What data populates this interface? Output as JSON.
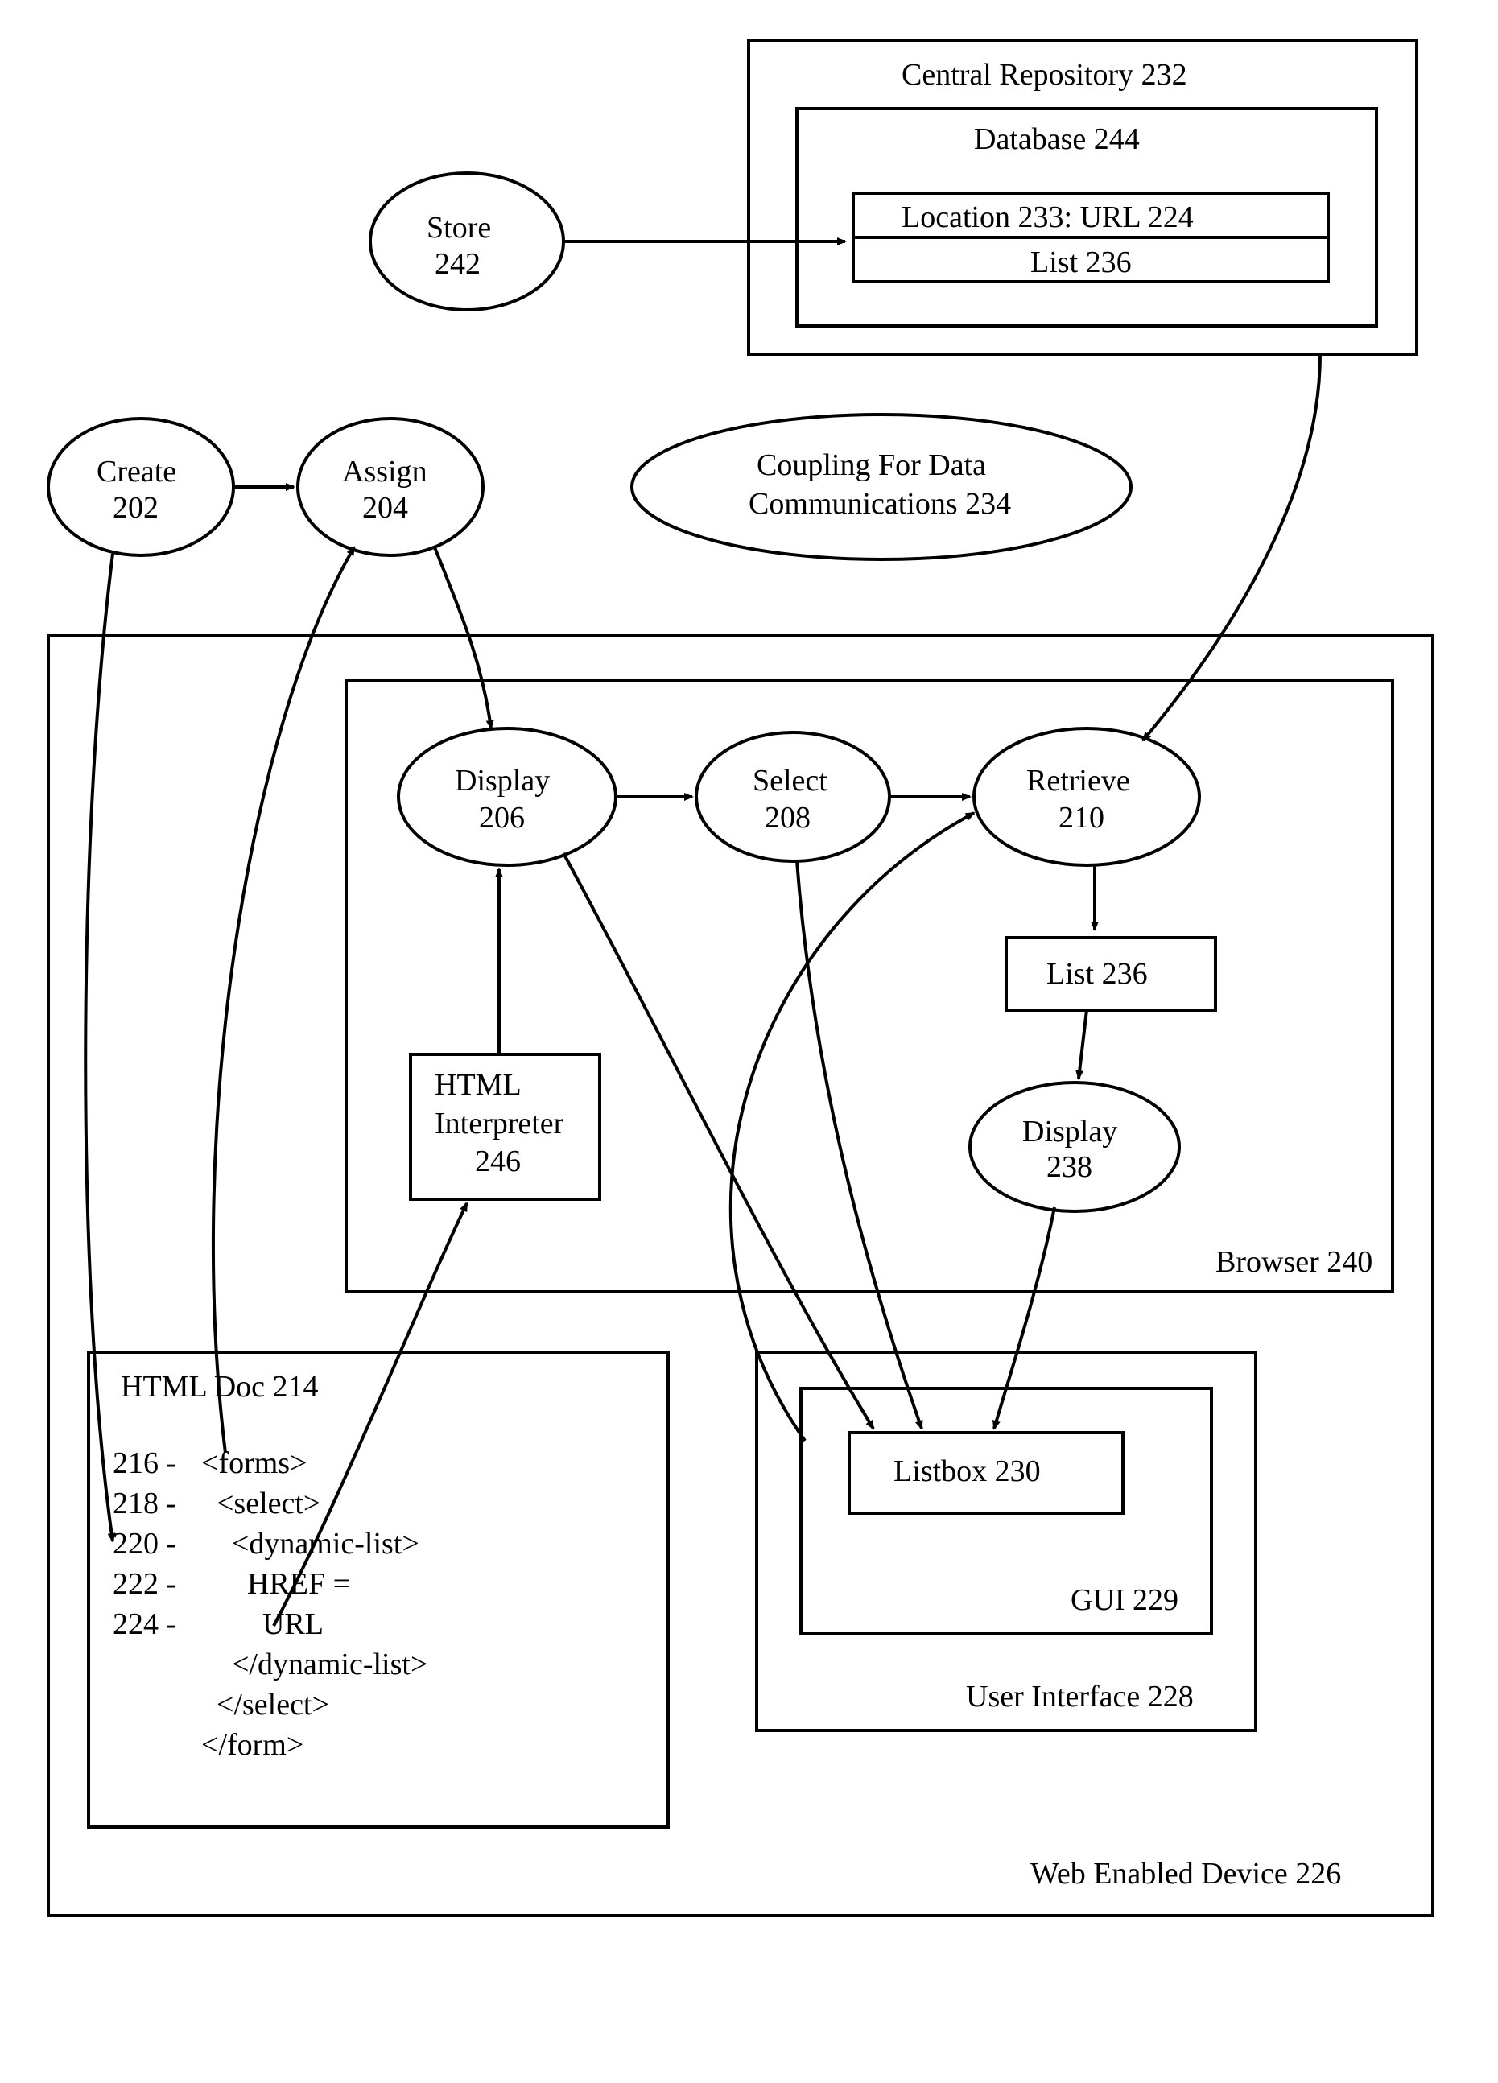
{
  "repo": {
    "title": "Central Repository 232"
  },
  "db": {
    "title": "Database 244",
    "row1": "Location 233: URL 224",
    "row2": "List 236"
  },
  "store": {
    "l1": "Store",
    "l2": "242"
  },
  "create": {
    "l1": "Create",
    "l2": "202"
  },
  "assign": {
    "l1": "Assign",
    "l2": "204"
  },
  "coupling": {
    "l1": "Coupling For Data",
    "l2": "Communications 234"
  },
  "browser": {
    "title": "Browser 240"
  },
  "display": {
    "l1": "Display",
    "l2": "206"
  },
  "select": {
    "l1": "Select",
    "l2": "208"
  },
  "retrieve": {
    "l1": "Retrieve",
    "l2": "210"
  },
  "list": {
    "l1": "List 236"
  },
  "display2": {
    "l1": "Display",
    "l2": "238"
  },
  "interp": {
    "l1": "HTML",
    "l2": "Interpreter",
    "l3": "246"
  },
  "device": {
    "title": "Web Enabled Device 226"
  },
  "ui": {
    "title": "User Interface 228"
  },
  "gui": {
    "title": "GUI 229"
  },
  "listbox": {
    "title": "Listbox 230"
  },
  "doc": {
    "title": "HTML Doc 214",
    "n216": "216 -",
    "t216": "<forms>",
    "n218": "218 -",
    "t218": "  <select>",
    "n220": "220 -",
    "t220": "    <dynamic-list>",
    "n222": "222 -",
    "t222": "      HREF =",
    "n224": "224 -",
    "t224": "        URL",
    "t6": "    </dynamic-list>",
    "t7": "  </select>",
    "t8": "</form>"
  }
}
